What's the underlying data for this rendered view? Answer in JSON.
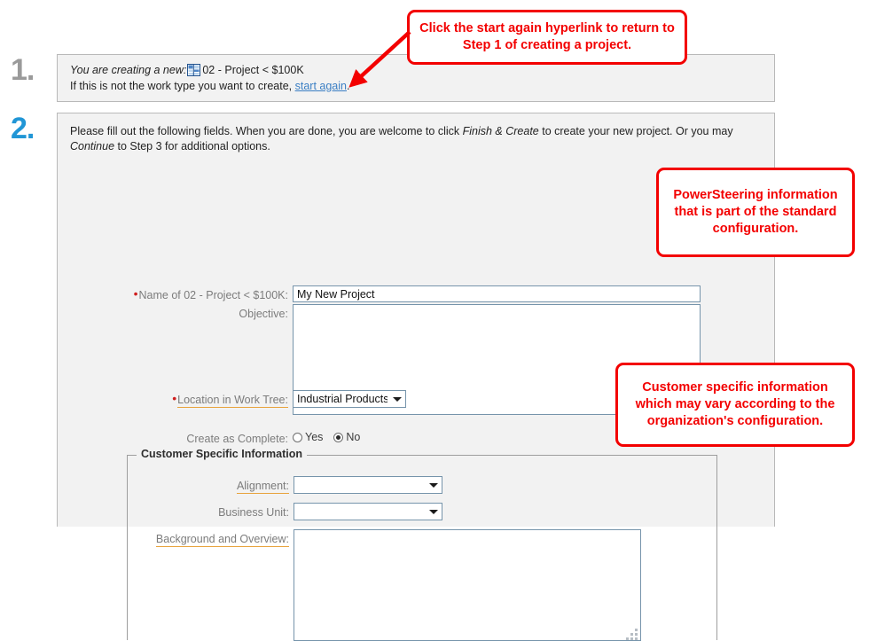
{
  "steps": {
    "one": "1.",
    "two": "2."
  },
  "step1": {
    "creating_prefix": "You are creating a new:",
    "work_type_icon": "work-type-grid-icon",
    "work_type_name": "02 - Project < $100K",
    "not_type_prefix": "If this is not the work type you want to create, ",
    "start_again_link": "start again",
    "not_type_suffix": "."
  },
  "step2": {
    "intro_1": "Please fill out the following fields. When you are done, you are welcome to click ",
    "intro_em_1": "Finish & Create",
    "intro_2": " to create your new project. Or you may ",
    "intro_em_2": "Continue",
    "intro_3": " to Step 3 for additional options.",
    "fields": {
      "name": {
        "label": "Name of 02 - Project < $100K:",
        "required": true,
        "value": "My New Project",
        "placeholder": ""
      },
      "objective": {
        "label": "Objective:",
        "required": false,
        "value": "",
        "placeholder": ""
      },
      "location": {
        "label": "Location in Work Tree:",
        "required": true,
        "value": "Industrial Products",
        "options": [
          "Industrial Products"
        ]
      },
      "create_as_complete": {
        "label": "Create as Complete:",
        "selected": "No",
        "options": [
          "Yes",
          "No"
        ]
      }
    },
    "customer_section": {
      "legend": "Customer Specific Information",
      "fields": {
        "alignment": {
          "label": "Alignment:",
          "value": "",
          "options": [
            ""
          ]
        },
        "business_unit": {
          "label": "Business Unit:",
          "value": "",
          "options": [
            ""
          ]
        },
        "background": {
          "label": "Background and Overview:",
          "value": "",
          "placeholder": ""
        }
      }
    }
  },
  "callouts": {
    "one": "Click the start again hyperlink to return to Step 1 of creating a project.",
    "two": "PowerSteering information that is part of the standard configuration.",
    "three": "Customer specific information which may vary according to the organization's configuration."
  },
  "colors": {
    "callout_red": "#f30000",
    "link_blue": "#3b7fc4",
    "step_active_blue": "#2196d6",
    "step_inactive_gray": "#9a9a9a",
    "required_dot_red": "#cf2020",
    "label_underline_orange": "#e8a33d",
    "input_border_blue": "#7694ab",
    "panel_bg": "#f2f2f2",
    "panel_border": "#b9b9b9"
  }
}
